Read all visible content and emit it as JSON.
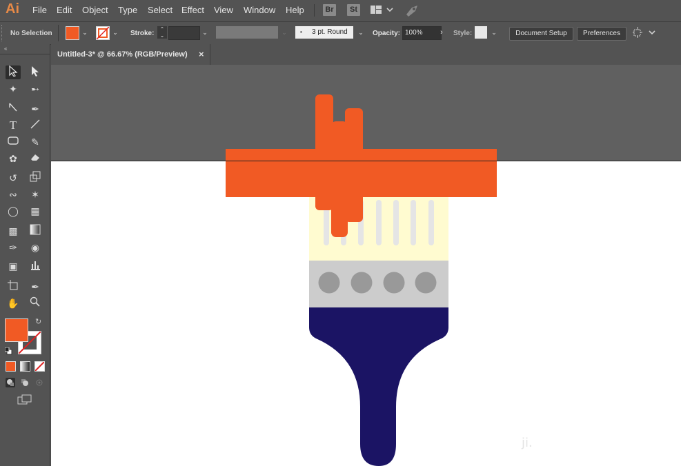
{
  "app": {
    "logo": "Ai"
  },
  "menu": [
    "File",
    "Edit",
    "Object",
    "Type",
    "Select",
    "Effect",
    "View",
    "Window",
    "Help"
  ],
  "menu_extras": {
    "bridge": "Br",
    "stock": "St"
  },
  "control": {
    "selection": "No Selection",
    "stroke_label": "Stroke:",
    "brush": "3 pt. Round",
    "opacity_label": "Opacity:",
    "opacity_value": "100%",
    "style_label": "Style:",
    "doc_setup": "Document Setup",
    "preferences": "Preferences",
    "fill_color": "#f15a24"
  },
  "document": {
    "tab_title": "Untitled-3* @ 66.67% (RGB/Preview)",
    "close": "×"
  },
  "colors": {
    "paint": "#f15a24",
    "bristle_bg": "#fffbd0",
    "bristle": "#e5e5e5",
    "ferrule": "#cccccc",
    "rivet": "#999999",
    "handle": "#1b1464"
  },
  "watermark": "ji."
}
